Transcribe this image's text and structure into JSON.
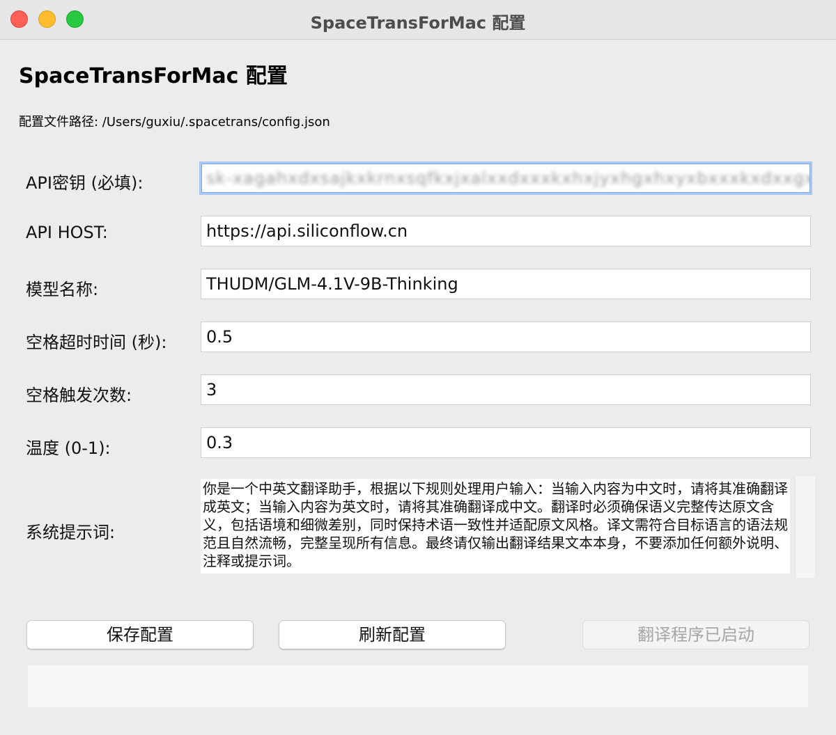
{
  "window": {
    "title": "SpaceTransForMac 配置"
  },
  "header": {
    "title": "SpaceTransForMac 配置",
    "config_path": "配置文件路径: /Users/guxiu/.spacetrans/config.json"
  },
  "form": {
    "api_key": {
      "label": "API密钥 (必填):",
      "value": "sk-xagahxdxsajkxkrnxsqfkxjxalxxdxxxkxhxjyxhgxhxyxbxxxkxdxxgx"
    },
    "api_host": {
      "label": "API HOST:",
      "value": "https://api.siliconflow.cn"
    },
    "model": {
      "label": "模型名称:",
      "value": "THUDM/GLM-4.1V-9B-Thinking"
    },
    "space_timeout": {
      "label": "空格超时时间 (秒):",
      "value": "0.5"
    },
    "space_count": {
      "label": "空格触发次数:",
      "value": "3"
    },
    "temperature": {
      "label": "温度 (0-1):",
      "value": "0.3"
    },
    "system_prompt": {
      "label": "系统提示词:",
      "value": "你是一个中英文翻译助手，根据以下规则处理用户输入：当输入内容为中文时，请将其准确翻译成英文；当输入内容为英文时，请将其准确翻译成中文。翻译时必须确保语义完整传达原文含义，包括语境和细微差别，同时保持术语一致性并适配原文风格。译文需符合目标语言的语法规范且自然流畅，完整呈现所有信息。最终请仅输出翻译结果文本本身，不要添加任何额外说明、注释或提示词。"
    }
  },
  "buttons": {
    "save": "保存配置",
    "refresh": "刷新配置",
    "running": "翻译程序已启动"
  },
  "status": {
    "text": ""
  }
}
